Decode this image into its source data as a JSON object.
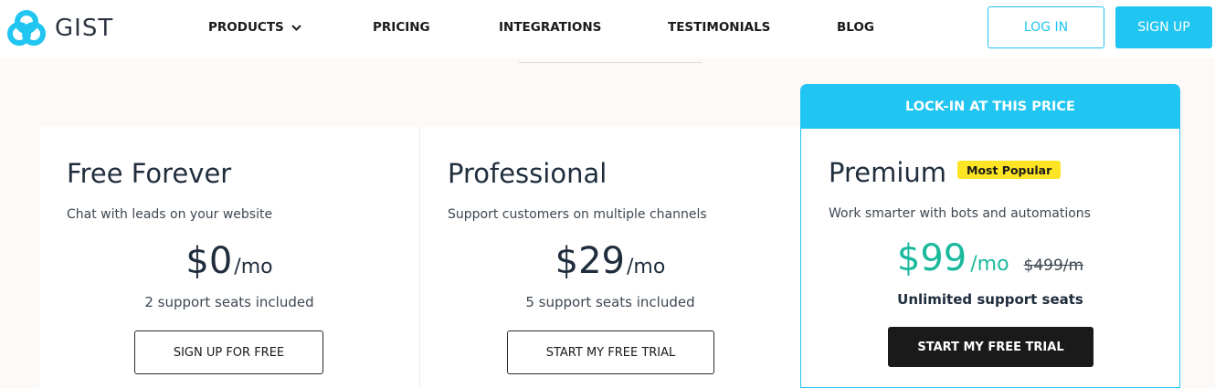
{
  "brand": {
    "name": "GIST",
    "color": "#20c5f1"
  },
  "nav": {
    "products": "PRODUCTS",
    "pricing": "PRICING",
    "integrations": "INTEGRATIONS",
    "testimonials": "TESTIMONIALS",
    "blog": "BLOG",
    "login": "LOG IN",
    "signup": "SIGN UP"
  },
  "plans": [
    {
      "name": "Free Forever",
      "description": "Chat with leads on your website",
      "price": "$0",
      "period": "/mo",
      "seats": "2 support seats included",
      "cta": "SIGN UP FOR FREE"
    },
    {
      "name": "Professional",
      "description": "Support customers on multiple channels",
      "price": "$29",
      "period": "/mo",
      "seats": "5 support seats included",
      "cta": "START MY FREE TRIAL"
    },
    {
      "header": "LOCK-IN AT THIS PRICE",
      "name": "Premium",
      "badge": "Most Popular",
      "description": "Work smarter with bots and automations",
      "price": "$99",
      "period": "/mo",
      "original_price": "$499/m",
      "seats": "Unlimited support seats",
      "cta": "START MY FREE TRIAL",
      "price_color": "#1ab99d",
      "badge_color": "#fde525"
    }
  ]
}
